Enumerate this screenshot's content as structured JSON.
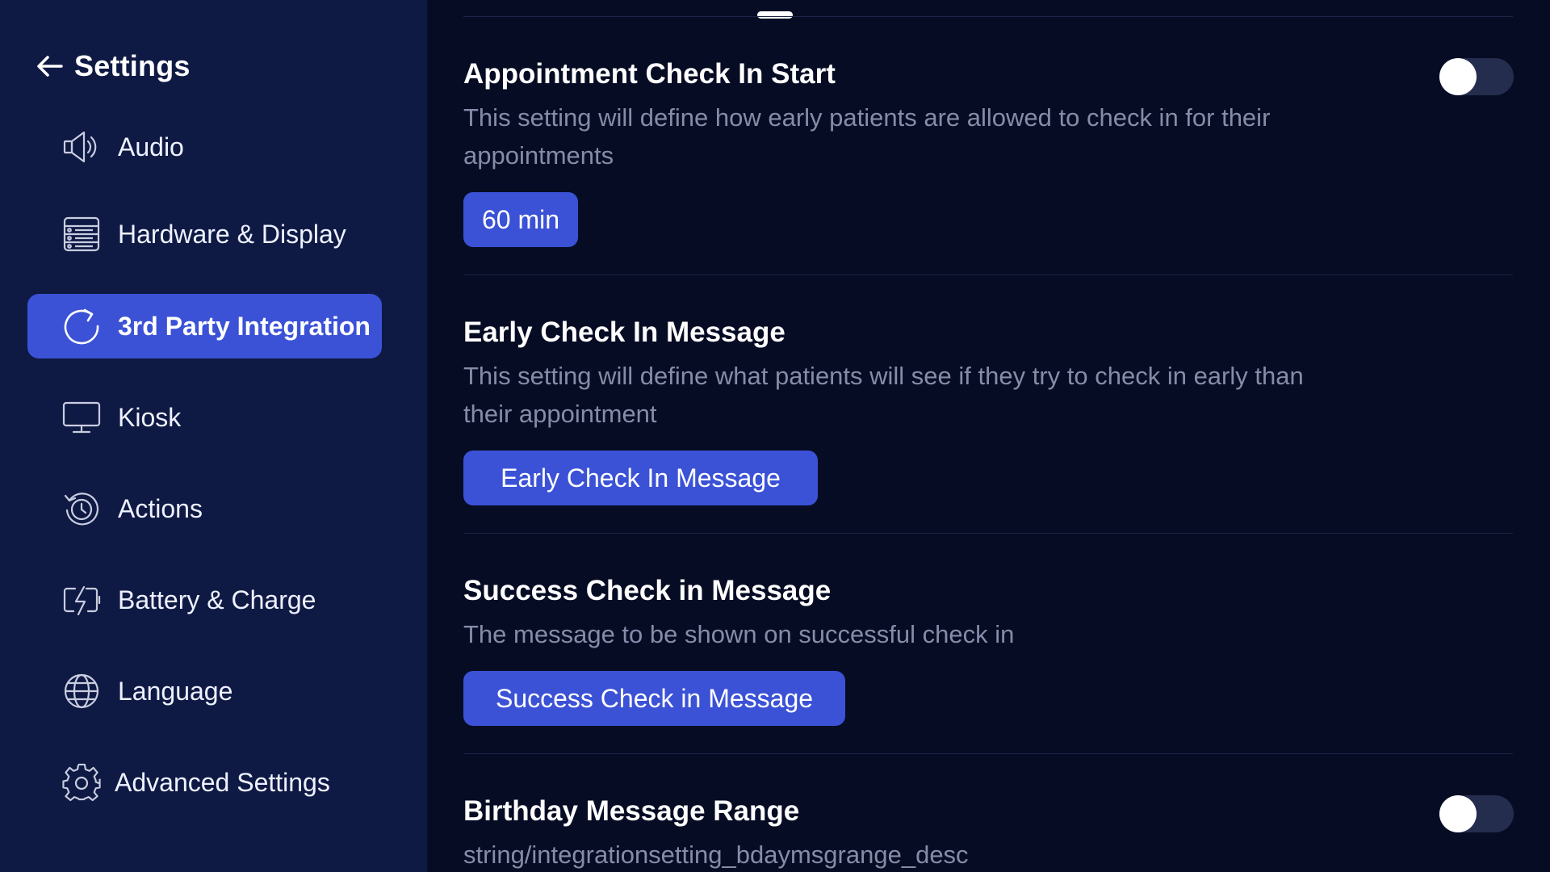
{
  "sidebar": {
    "title": "Settings",
    "items": [
      {
        "label": "Audio",
        "icon": "speaker-icon",
        "active": false
      },
      {
        "label": "Hardware & Display",
        "icon": "server-list-icon",
        "active": false
      },
      {
        "label": "3rd Party Integration",
        "icon": "refresh-icon",
        "active": true
      },
      {
        "label": "Kiosk",
        "icon": "monitor-icon",
        "active": false
      },
      {
        "label": "Actions",
        "icon": "history-icon",
        "active": false
      },
      {
        "label": "Battery & Charge",
        "icon": "battery-charge-icon",
        "active": false
      },
      {
        "label": "Language",
        "icon": "globe-icon",
        "active": false
      },
      {
        "label": "Advanced Settings",
        "icon": "gear-icon",
        "active": false
      }
    ]
  },
  "settings": [
    {
      "title": "Appointment Check In Start",
      "description": "This setting will define how early patients are allowed to check in for their appointments",
      "button": "60 min",
      "toggle": false
    },
    {
      "title": "Early Check In Message",
      "description": "This setting will define what patients will see if they try to check in early than their appointment",
      "button": "Early Check In Message"
    },
    {
      "title": "Success Check in Message",
      "description": "The message to be shown on successful check in",
      "button": "Success Check in Message"
    },
    {
      "title": "Birthday Message Range",
      "description": "string/integrationsetting_bdaymsgrange_desc",
      "toggle": false
    }
  ],
  "colors": {
    "accent": "#3b52d6",
    "sidebar_bg": "#0f1a44",
    "main_bg": "#060c24",
    "muted_text": "#868ca8"
  }
}
